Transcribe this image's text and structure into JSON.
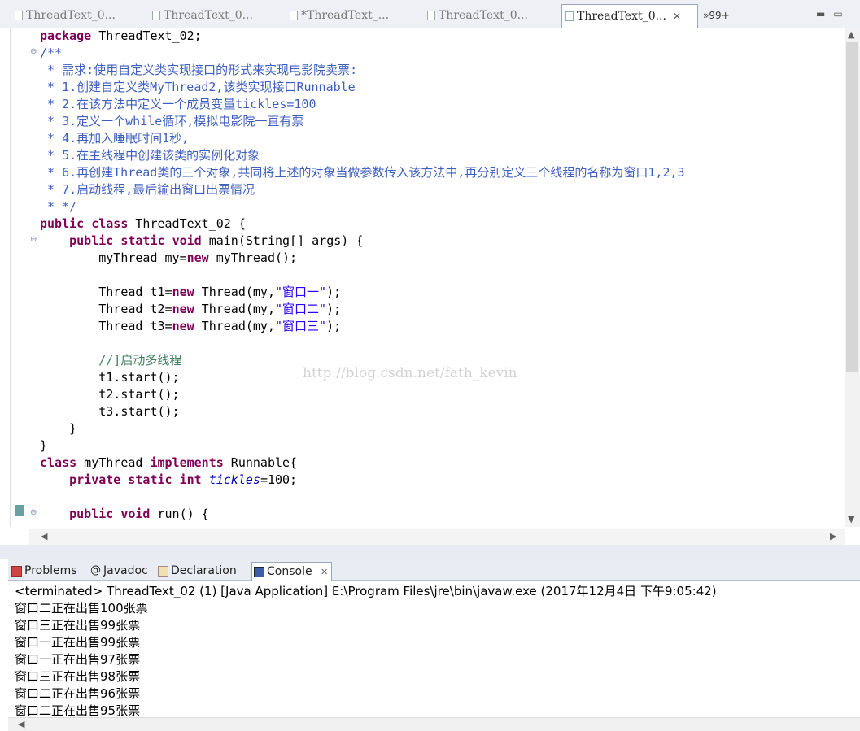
{
  "editor_tabs": [
    {
      "label": "ThreadText_0..."
    },
    {
      "label": "ThreadText_0..."
    },
    {
      "label": "*ThreadText_..."
    },
    {
      "label": "ThreadText_0..."
    },
    {
      "label": "ThreadText_0...",
      "active": true
    }
  ],
  "overflow_label": "»99+",
  "code_lines": [
    "package ThreadText_02;",
    "/**",
    " * 需求:使用自定义类实现接口的形式来实现电影院卖票:",
    " * 1.创建自定义类MyThread2,该类实现接口Runnable",
    " * 2.在该方法中定义一个成员变量tickles=100",
    " * 3.定义一个while循环,模拟电影院一直有票",
    " * 4.再加入睡眠时间1秒,",
    " * 5.在主线程中创建该类的实例化对象",
    " * 6.再创建Thread类的三个对象,共同将上述的对象当做参数传入该方法中,再分别定义三个线程的名称为窗口1,2,3",
    " * 7.启动线程,最后输出窗口出票情况",
    " * */",
    "public class ThreadText_02 {",
    "    public static void main(String[] args) {",
    "        myThread my=new myThread();",
    "",
    "        Thread t1=new Thread(my,\"窗口一\");",
    "        Thread t2=new Thread(my,\"窗口二\");",
    "        Thread t3=new Thread(my,\"窗口三\");",
    "",
    "        //]启动多线程",
    "        t1.start();",
    "        t2.start();",
    "        t3.start();",
    "    }",
    "}",
    "class myThread implements Runnable{",
    "    private static int tickles=100;",
    "",
    "    public void run() {"
  ],
  "watermark": "http://blog.csdn.net/fath_kevin",
  "view_tabs": [
    {
      "label": "Problems"
    },
    {
      "label": "Javadoc"
    },
    {
      "label": "Declaration"
    },
    {
      "label": "Console",
      "active": true
    }
  ],
  "console": {
    "header": "<terminated> ThreadText_02 (1) [Java Application] E:\\Program Files\\jre\\bin\\javaw.exe (2017年12月4日 下午9:05:42)",
    "lines": [
      "窗口二正在出售100张票",
      "窗口三正在出售99张票",
      "窗口一正在出售99张票",
      "窗口一正在出售97张票",
      "窗口三正在出售98张票",
      "窗口二正在出售96张票",
      "窗口二正在出售95张票"
    ]
  },
  "colors": {
    "keyword": "#7f0055",
    "javadoc": "#3f5fbf",
    "comment": "#3f7f5f",
    "string": "#2a00ff",
    "field": "#0000c0"
  }
}
